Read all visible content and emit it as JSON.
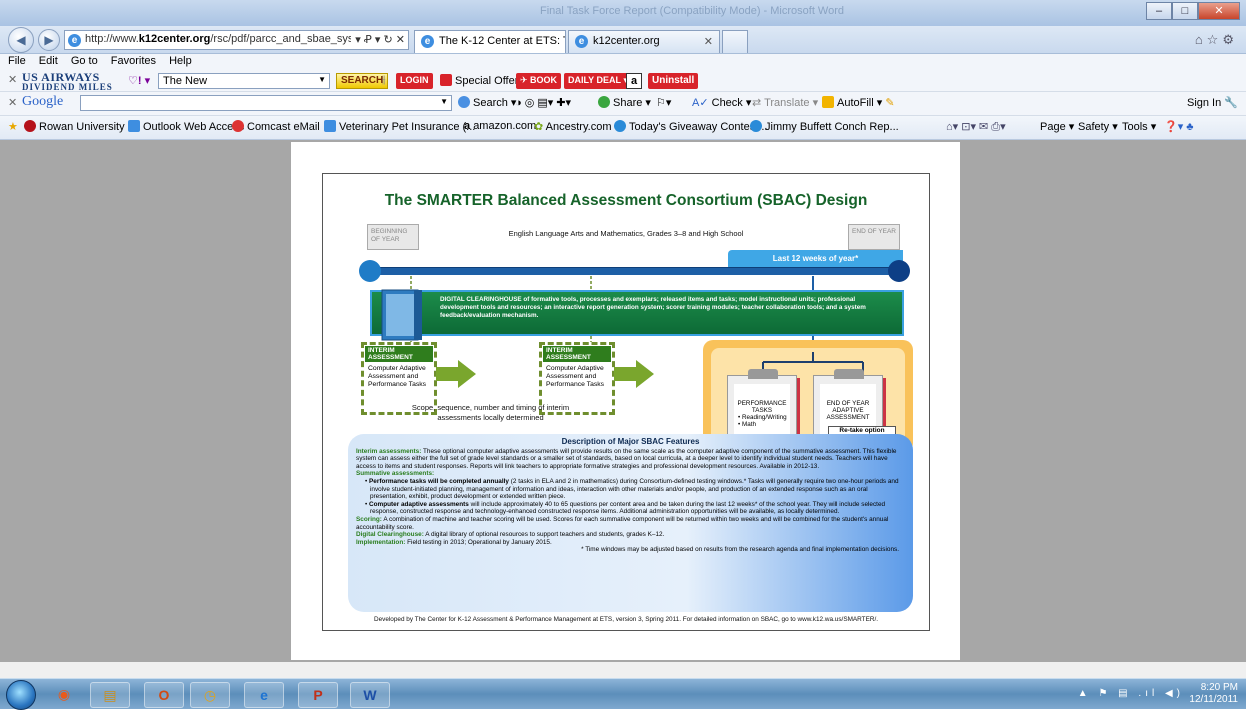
{
  "window": {
    "ghost_title": "Final Task Force Report (Compatibility Mode) - Microsoft Word"
  },
  "nav": {
    "url_prefix": "http://www.",
    "url_domain": "k12center.org",
    "url_path": "/rsc/pdf/parcc_and_sbae_systems.p",
    "addr_controls": "▾ Ꝓ ▾ ↻ ✕",
    "tabs": [
      {
        "label": "The K-12 Center at ETS: The As..."
      },
      {
        "label": "k12center.org"
      }
    ]
  },
  "menu": [
    "File",
    "Edit",
    "Go to",
    "Favorites",
    "Help"
  ],
  "toolbar1": {
    "usair_line1": "US AIRWAYS",
    "usair_line2": "DIVIDEND MILES",
    "yahoo": "♡! ▾",
    "new_combo": "The New",
    "search": "SEARCH",
    "login": "LOGIN",
    "special_offers": "Special Offers",
    "book": "BOOK",
    "daily_deal": "DAILY DEAL",
    "amazon": "a",
    "uninstall": "Uninstall"
  },
  "toolbar2": {
    "google": "Google",
    "search": "Search",
    "share": "Share",
    "check": "Check",
    "translate": "Translate",
    "autofill": "AutoFill",
    "signin": "Sign In"
  },
  "favorites": {
    "items": [
      "Rowan University",
      "Outlook Web Access",
      "Comcast eMail",
      "Veterinary Pet Insurance (...",
      "amazon.com",
      "Ancestry.com",
      "Today's Giveaway Contest...",
      "Jimmy Buffett Conch Rep..."
    ],
    "right": [
      "Page ▾",
      "Safety ▾",
      "Tools ▾"
    ]
  },
  "doc": {
    "title": "The SMARTER Balanced Assessment Consortium (SBAC) Design",
    "beginning": "BEGINNING OF YEAR",
    "end": "END OF YEAR",
    "subtitle": "English Language Arts and Mathematics, Grades 3–8 and High School",
    "last12": "Last 12 weeks of year*",
    "clearing": "DIGITAL CLEARINGHOUSE of formative tools, processes and exemplars; released items and tasks; model instructional units; professional development tools and resources; an interactive report generation system; scorer training modules; teacher collaboration tools; and a system feedback/evaluation mechanism.",
    "interim_hdr": "INTERIM ASSESSMENT",
    "interim_body": "Computer Adaptive Assessment and Performance Tasks",
    "scope": "Scope, sequence, number and timing of interim assessments locally determined",
    "perf_tasks": "PERFORMANCE TASKS",
    "perf_sub": "• Reading/Writing • Math",
    "eoy": "END OF YEAR ADAPTIVE ASSESSMENT",
    "retake": "Re-take option",
    "desc_title": "Description of Major SBAC Features",
    "desc_interim_label": "Interim assessments:",
    "desc_interim": "These optional computer adaptive assessments will provide results on the same scale as the computer adaptive component of the summative assessment. This flexible system can assess either the full set of grade level standards or a smaller set of standards, based on local curricula, at a deeper level to identify individual student needs. Teachers will have access to items and student responses. Reports will link teachers to appropriate formative strategies and professional development resources. Available in 2012-13.",
    "desc_summ_label": "Summative assessments:",
    "desc_b1_bold": "Performance tasks will be completed annually",
    "desc_b1": "(2 tasks in ELA and 2 in mathematics) during Consortium-defined testing windows.* Tasks will generally require two one-hour periods and involve student-initiated planning, management of information and ideas, interaction with other materials and/or people, and production of an extended response such as an oral presentation, exhibit, product development or extended written piece.",
    "desc_b2_bold": "Computer adaptive assessments",
    "desc_b2": "will include approximately 40 to 65 questions per content area and be taken during the last 12 weeks* of the school year. They will include selected response, constructed response and technology-enhanced constructed response items. Additional administration opportunities will be available, as locally determined.",
    "desc_scoring_label": "Scoring:",
    "desc_scoring": "A combination of machine and teacher scoring will be used. Scores for each summative component will be returned within two weeks and will be combined for the student's annual accountability score.",
    "desc_dc_label": "Digital Clearinghouse:",
    "desc_dc": "A digital library of optional resources to support teachers and students, grades K–12.",
    "desc_impl_label": "Implementation:",
    "desc_impl": "Field testing in 2013; Operational by January 2015.",
    "desc_note": "* Time windows may be adjusted based on results from the research agenda and final implementation decisions.",
    "devby": "Developed by The Center for K-12 Assessment & Performance Management at ETS, version 3, Spring 2011.   For detailed information on SBAC, go to www.k12.wa.us/SMARTER/."
  },
  "taskbar": {
    "time": "8:20 PM",
    "date": "12/11/2011"
  },
  "colors": {
    "title_green": "#16632a",
    "timeline_blue": "#1d5fa6",
    "clearing_green": "#0d6a36"
  }
}
